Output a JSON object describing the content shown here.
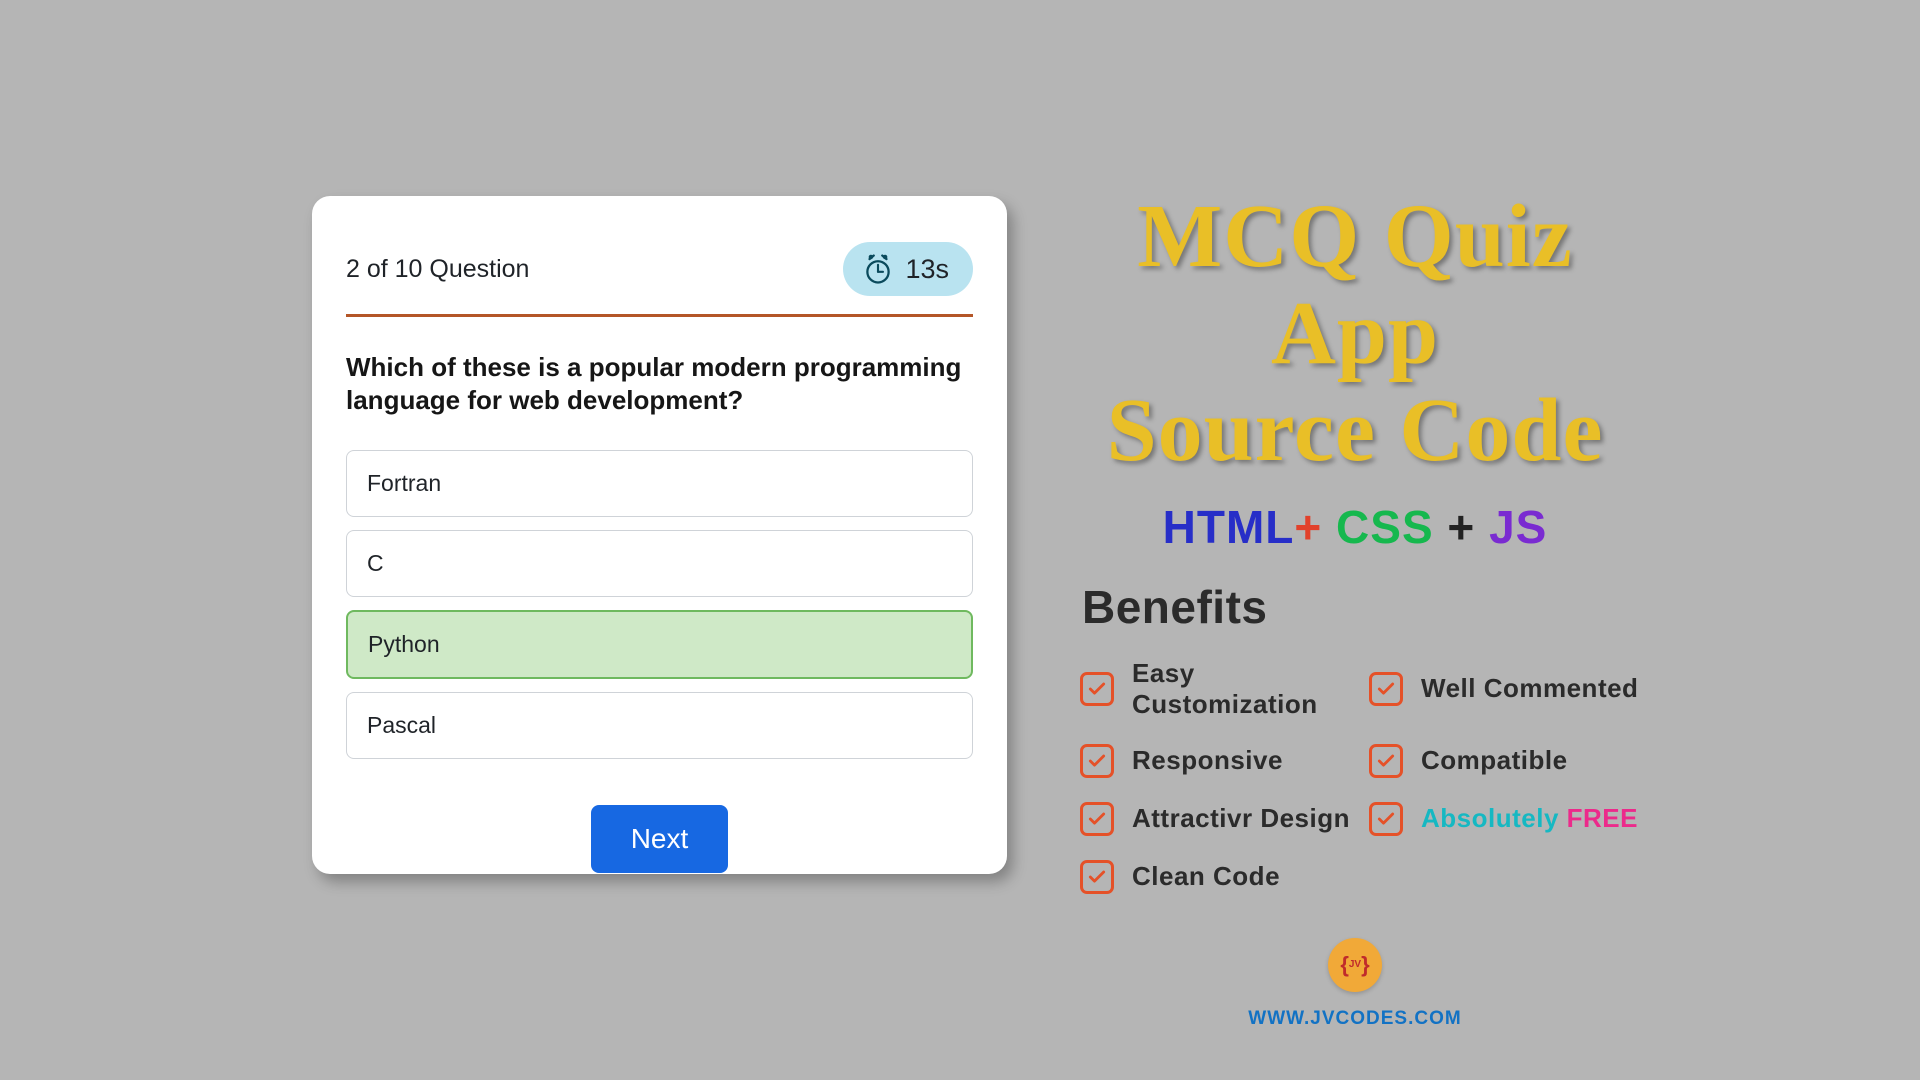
{
  "quiz": {
    "progress": "2 of 10 Question",
    "timer": "13s",
    "question": "Which of these is a popular modern programming language for web development?",
    "options": [
      "Fortran",
      "C",
      "Python",
      "Pascal"
    ],
    "selected_index": 2,
    "next_label": "Next"
  },
  "promo": {
    "title_line1": "MCQ Quiz App",
    "title_line2": "Source Code",
    "subtitle": {
      "html": "HTML",
      "plus1": "+ ",
      "css": "CSS",
      "plus2": " + ",
      "js": "JS"
    },
    "benefits_heading": "Benefits",
    "benefits_left": [
      "Easy Customization",
      "Responsive",
      "Attractivr Design",
      "Clean Code"
    ],
    "benefits_right_plain": [
      "Well Commented",
      "Compatible"
    ],
    "free_label_1": "Absolutely ",
    "free_label_2": "FREE",
    "logo_text": "JV",
    "url": "WWW.JVCODES.COM"
  },
  "colors": {
    "accent_orange": "#e55128",
    "accent_blue": "#1768e2"
  }
}
